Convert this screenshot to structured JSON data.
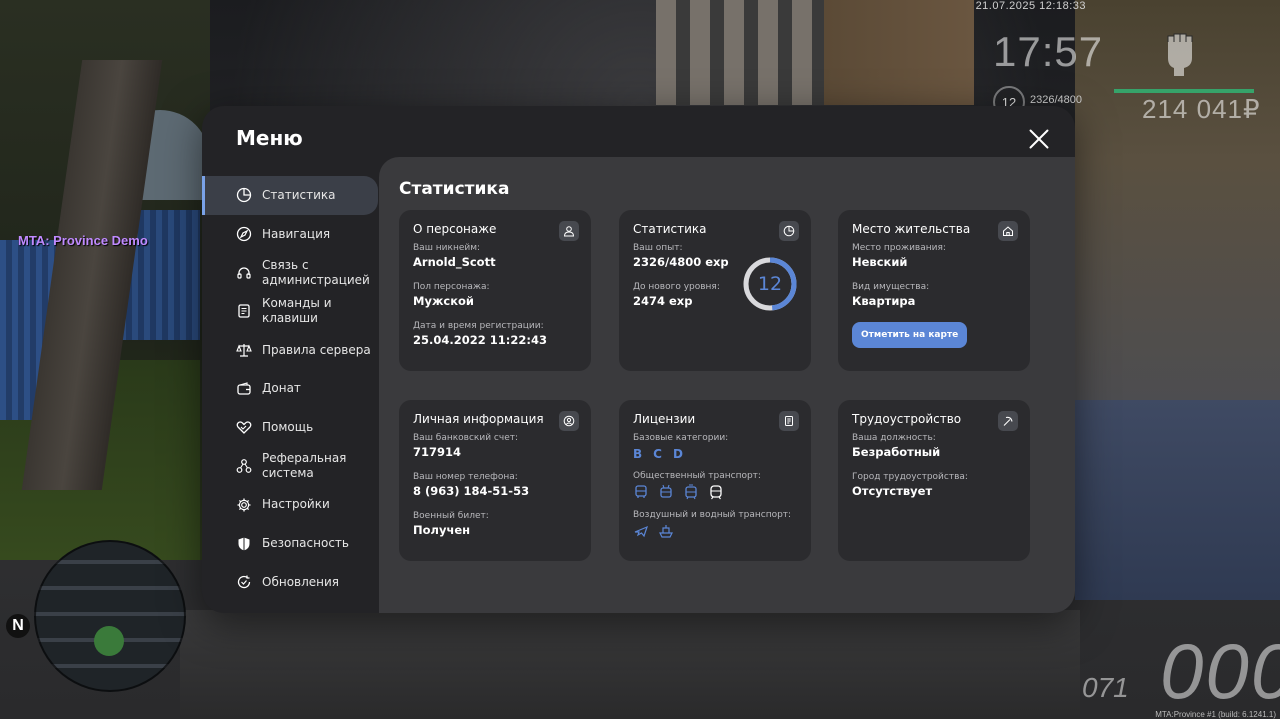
{
  "hud": {
    "datetime": "21.07.2025 12:18:33",
    "clock": "17:57",
    "level": "12",
    "exp": "2326/4800",
    "money": "214 041₽",
    "server_tag": "MTA: Province Demo",
    "compass": "N",
    "speed": "000",
    "fuel": "071",
    "build": "MTA:Province #1 (build: 6.1241.1)"
  },
  "menu": {
    "title": "Меню",
    "nav": [
      {
        "label": "Статистика",
        "icon": "pie-chart-icon",
        "active": true
      },
      {
        "label": "Навигация",
        "icon": "compass-icon"
      },
      {
        "label": "Связь с администрацией",
        "icon": "headset-icon"
      },
      {
        "label": "Команды и клавиши",
        "icon": "document-icon"
      },
      {
        "label": "Правила сервера",
        "icon": "scales-icon"
      },
      {
        "label": "Донат",
        "icon": "wallet-icon"
      },
      {
        "label": "Помощь",
        "icon": "handshake-icon"
      },
      {
        "label": "Реферальная система",
        "icon": "network-icon"
      },
      {
        "label": "Настройки",
        "icon": "gear-icon"
      },
      {
        "label": "Безопасность",
        "icon": "shield-icon"
      },
      {
        "label": "Обновления",
        "icon": "refresh-check-icon"
      }
    ]
  },
  "content": {
    "title": "Статистика",
    "character": {
      "title": "О персонаже",
      "nickname_label": "Ваш никнейм:",
      "nickname": "Arnold_Scott",
      "gender_label": "Пол персонажа:",
      "gender": "Мужской",
      "reg_label": "Дата и время регистрации:",
      "reg": "25.04.2022 11:22:43"
    },
    "stats": {
      "title": "Статистика",
      "exp_label": "Ваш опыт:",
      "exp": "2326/4800 exp",
      "next_label": "До нового уровня:",
      "next": "2474 exp",
      "level": "12",
      "progress": 0.4846
    },
    "residence": {
      "title": "Место жительства",
      "place_label": "Место проживания:",
      "place": "Невский",
      "type_label": "Вид имущества:",
      "type": "Квартира",
      "button": "Отметить на карте"
    },
    "personal": {
      "title": "Личная информация",
      "bank_label": "Ваш банковский счет:",
      "bank": "717914",
      "phone_label": "Ваш номер телефона:",
      "phone": "8 (963) 184-51-53",
      "military_label": "Военный билет:",
      "military": "Получен"
    },
    "licenses": {
      "title": "Лицензии",
      "basic_label": "Базовые категории:",
      "basic": [
        "B",
        "C",
        "D"
      ],
      "public_label": "Общественный транспорт:",
      "air_label": "Воздушный и водный транспорт:"
    },
    "employment": {
      "title": "Трудоустройство",
      "position_label": "Ваша должность:",
      "position": "Безработный",
      "city_label": "Город трудоустройства:",
      "city": "Отсутствует"
    }
  },
  "colors": {
    "accent": "#5b86d6",
    "panel": "#232326",
    "content": "#3a3a3d",
    "card": "#2b2b2e"
  }
}
